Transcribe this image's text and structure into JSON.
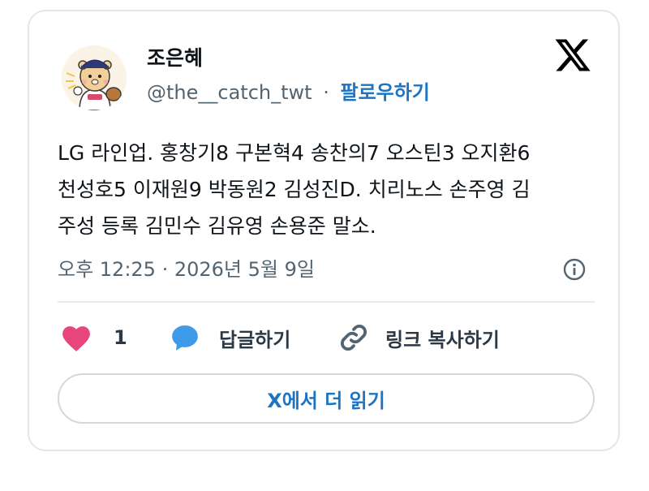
{
  "author": {
    "name": "조은혜",
    "handle": "@the__catch_twt",
    "separator": "·",
    "follow_label": "팔로우하기"
  },
  "tweet": {
    "lines": [
      "LG 라인업. 홍창기8 구본혁4 송찬의7 오스틴3 오지환6",
      "천성호5 이재원9 박동원2 김성진D. 치리노스 손주영 김",
      "주성 등록 김민수 김유영 손용준 말소."
    ],
    "timestamp": "오후 12:25 · 2026년 5월 9일"
  },
  "actions": {
    "like_count": "1",
    "reply_label": "답글하기",
    "copy_link_label": "링크 복사하기"
  },
  "read_more_label": "X에서 더 읽기",
  "icons": {
    "like": "heart-icon",
    "reply": "speech-bubble-icon",
    "copy": "link-icon",
    "info": "info-icon",
    "brand": "x-logo-icon"
  },
  "colors": {
    "accent": "#1d74c2",
    "like": "#e8457a",
    "reply": "#3d9be9",
    "muted": "#536471"
  }
}
